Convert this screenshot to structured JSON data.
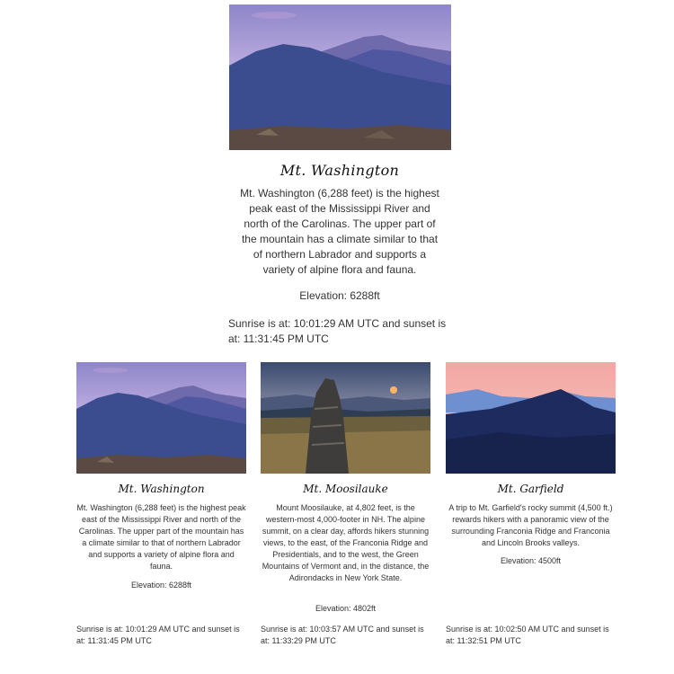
{
  "featured": {
    "image": "mt-washington-photo",
    "title": "Mt. Washington",
    "description": "Mt. Washington (6,288 feet) is the highest peak east of the Mississippi River and north of the Carolinas. The upper part of the mountain has a climate similar to that of northern Labrador and supports a variety of alpine flora and fauna.",
    "elevation": "Elevation: 6288ft",
    "sun": "Sunrise is at: 10:01:29 AM UTC and sunset is at: 11:31:45 PM UTC"
  },
  "cards": [
    {
      "image": "mt-washington-photo",
      "title": "Mt. Washington",
      "description": "Mt. Washington (6,288 feet) is the highest peak east of the Mississippi River and north of the Carolinas. The upper part of the mountain has a climate similar to that of northern Labrador and supports a variety of alpine flora and fauna.",
      "elevation": "Elevation: 6288ft",
      "sun": "Sunrise is at: 10:01:29 AM UTC and sunset is at: 11:31:45 PM UTC"
    },
    {
      "image": "mt-moosilauke-photo",
      "title": "Mt. Moosilauke",
      "description": "Mount Moosilauke, at 4,802 feet, is the western-most 4,000-footer in NH. The alpine summit, on a clear day, affords hikers stunning views, to the east, of the Franconia Ridge and Presidentials, and to the west, the Green Mountains of Vermont and, in the distance, the Adirondacks in New York State.",
      "elevation": "Elevation: 4802ft",
      "sun": "Sunrise is at: 10:03:57 AM UTC and sunset is at: 11:33:29 PM UTC"
    },
    {
      "image": "mt-garfield-photo",
      "title": "Mt. Garfield",
      "description": "A trip to Mt. Garfield's rocky summit (4,500 ft.) rewards hikers with a panoramic view of the surrounding Franconia Ridge and Franconia and Lincoln Brooks valleys.",
      "elevation": "Elevation: 4500ft",
      "sun": "Sunrise is at: 10:02:50 AM UTC and sunset is at: 11:32:51 PM UTC"
    }
  ]
}
